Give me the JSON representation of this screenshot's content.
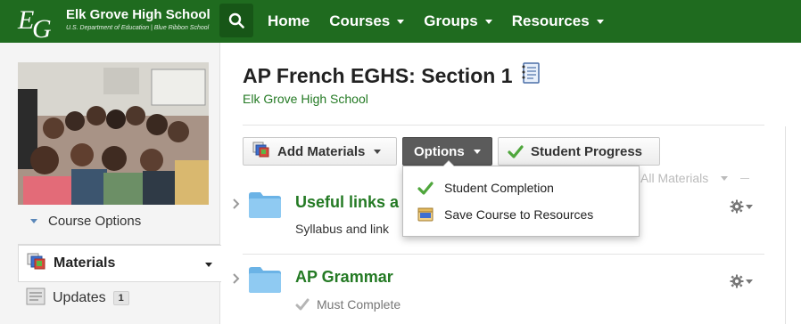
{
  "header": {
    "school_name": "Elk Grove High School",
    "school_subtitle": "U.S. Department of Education | Blue Ribbon School",
    "logo_letters": "EG",
    "brand_color": "#1f6b1f",
    "nav": [
      {
        "label": "Home",
        "has_caret": false
      },
      {
        "label": "Courses",
        "has_caret": true
      },
      {
        "label": "Groups",
        "has_caret": true
      },
      {
        "label": "Resources",
        "has_caret": true
      }
    ]
  },
  "sidebar": {
    "course_options_label": "Course Options",
    "items": [
      {
        "label": "Materials",
        "active": true
      },
      {
        "label": "Updates",
        "badge": "1"
      }
    ]
  },
  "main": {
    "title": "AP French EGHS: Section 1",
    "school_link": "Elk Grove High School",
    "toolbar": {
      "add_materials": "Add Materials",
      "options": "Options",
      "student_progress": "Student Progress"
    },
    "filter_label": "All Materials",
    "rows": [
      {
        "title": "Useful links a",
        "subtitle": "Syllabus and link"
      },
      {
        "title": "AP Grammar",
        "subtitle": "Must Complete"
      }
    ]
  },
  "options_menu": {
    "items": [
      {
        "label": "Student Completion",
        "icon": "check-icon"
      },
      {
        "label": "Save Course to Resources",
        "icon": "resources-box-icon"
      }
    ]
  }
}
